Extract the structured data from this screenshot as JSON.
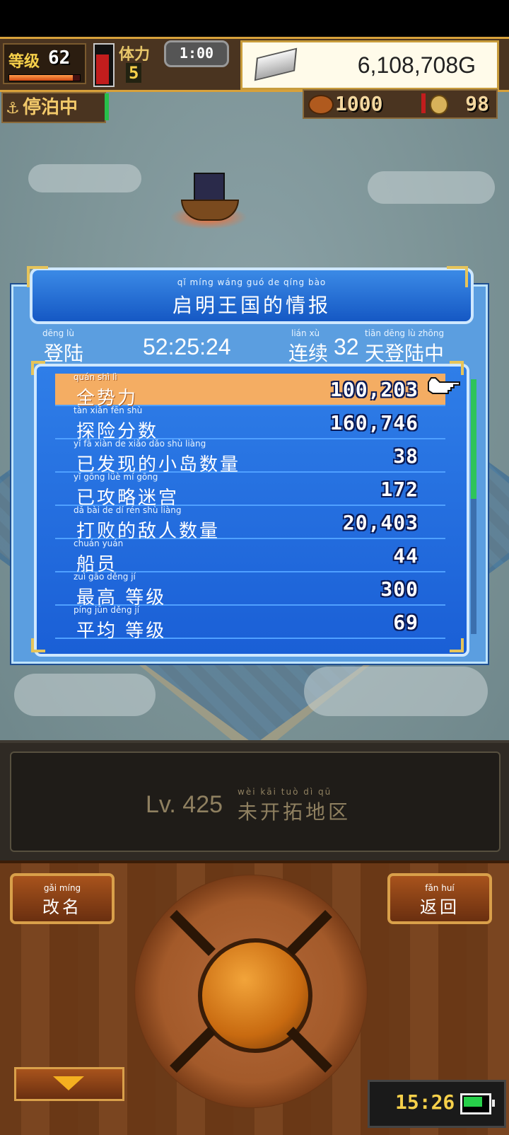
{
  "hud": {
    "level_label": "等级",
    "level": "62",
    "level_progress": 0.9,
    "red_gauge_fraction": 0.78,
    "stamina_label": "体力",
    "stamina": "5",
    "timer": "1:00",
    "gold": "6,108,708G",
    "status": "停泊中",
    "resource_food": "1000",
    "resource_coin": "98"
  },
  "panel": {
    "title_ruby": "qǐ míng wáng guó de qíng bào",
    "title": "启明王国的情报",
    "login_ruby": "dēng lù",
    "login_label": "登陆",
    "login_time": "52:25:24",
    "streak_ruby_a": "lián xù",
    "streak_prefix": "连续",
    "streak_days": "32",
    "streak_ruby_b": "tiān dēng lù zhōng",
    "streak_suffix": "天登陆中",
    "rows": [
      {
        "ruby": "quán shì lì",
        "label": "全势力",
        "value": "100,203",
        "selected": true
      },
      {
        "ruby": "tàn xiǎn fēn shù",
        "label": "探险分数",
        "value": "160,746"
      },
      {
        "ruby": "yǐ fā xiàn de xiǎo dǎo shù liàng",
        "label": "已发现的小岛数量",
        "value": "38"
      },
      {
        "ruby": "yǐ gōng lüè mí gōng",
        "label": "已攻略迷宫",
        "value": "172"
      },
      {
        "ruby": "dǎ bài de dí rén shù liàng",
        "label": "打败的敌人数量",
        "value": "20,403"
      },
      {
        "ruby": "chuán yuán",
        "label": "船员",
        "value": "44"
      },
      {
        "ruby": "zuì gāo děng jí",
        "label": "最高 等级",
        "value": "300"
      },
      {
        "ruby": "píng jūn děng jí",
        "label": "平均 等级",
        "value": "69"
      }
    ],
    "scroll_fraction": 0.47
  },
  "area": {
    "level": "Lv. 425",
    "ruby": "wèi kāi tuò dì qū",
    "name": "未开拓地区"
  },
  "buttons": {
    "rename_ruby": "gǎi míng",
    "rename": "改名",
    "back_ruby": "fǎn huí",
    "back": "返回"
  },
  "status_bar": {
    "clock": "15:26",
    "battery_level": 0.75
  },
  "colors": {
    "panel_blue": "#1a5fd6",
    "selected_row": "#f4ad63",
    "gold_accent": "#d9a04a"
  }
}
